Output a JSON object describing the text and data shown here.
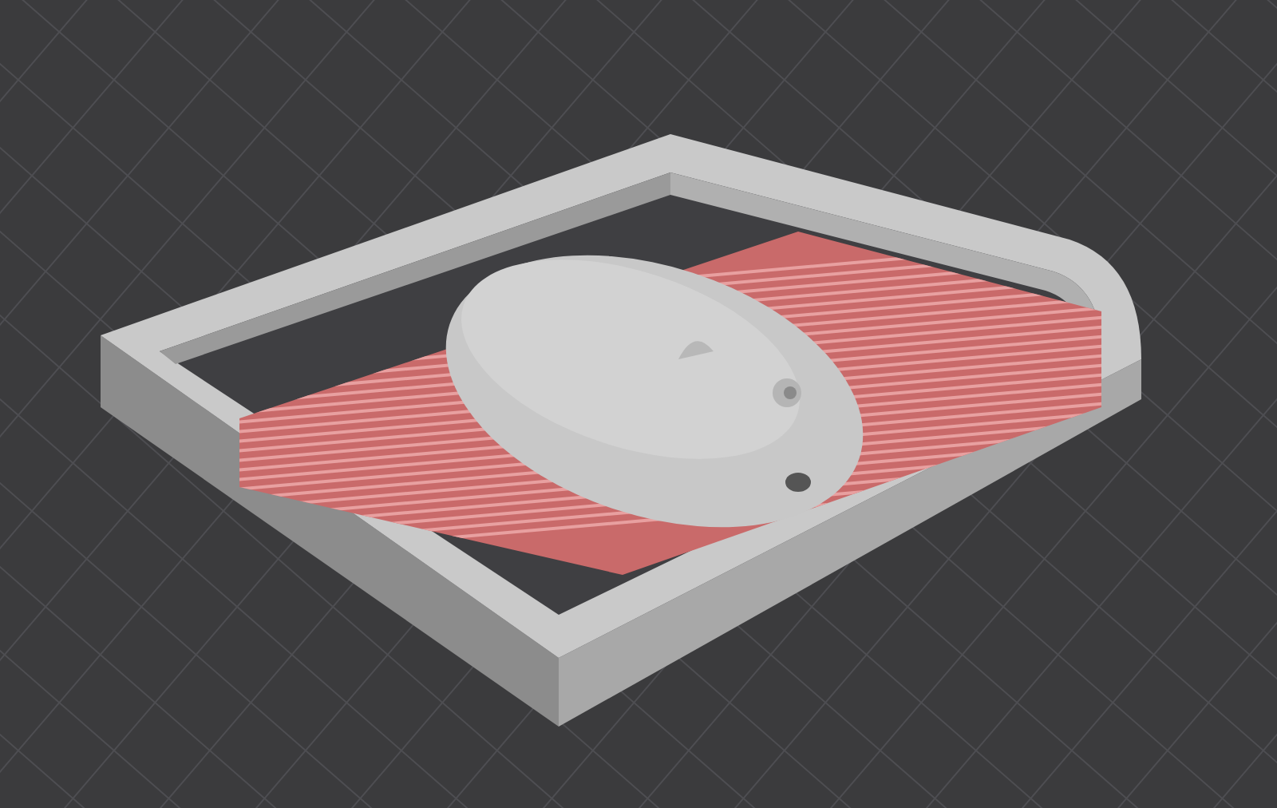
{
  "scene": {
    "supports_visible": true
  }
}
